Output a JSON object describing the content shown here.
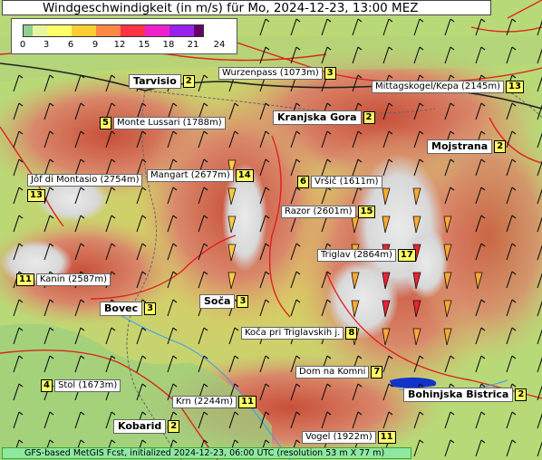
{
  "title": "Windgeschwindigkeit (in m/s) für Mo, 2024-12-23, 13:00 MEZ",
  "legend": {
    "ticks": [
      "0",
      "3",
      "6",
      "9",
      "12",
      "15",
      "18",
      "21",
      "24"
    ],
    "colors": [
      "#8fd18f",
      "#e8f5a0",
      "#ffff66",
      "#ffcc33",
      "#ff8844",
      "#ff3344",
      "#ee22cc",
      "#9922ee",
      "#660066"
    ]
  },
  "stations": [
    {
      "name": "Tarvisio",
      "value": "2",
      "bold": true
    },
    {
      "name": "Wurzenpass (1073m)",
      "value": "3",
      "bold": false
    },
    {
      "name": "Mittagskogel/Kepa (2145m)",
      "value": "13",
      "bold": false
    },
    {
      "name": "Monte Lussari (1788m)",
      "value": "5",
      "bold": false,
      "valueFirst": true
    },
    {
      "name": "Kranjska Gora",
      "value": "2",
      "bold": true
    },
    {
      "name": "Mojstrana",
      "value": "2",
      "bold": true
    },
    {
      "name": "Jôf di Montasio (2754m)",
      "value": "13",
      "bold": false,
      "valueBelow": true
    },
    {
      "name": "Mangart (2677m)",
      "value": "14",
      "bold": false
    },
    {
      "name": "Vršič (1611m)",
      "value": "6",
      "bold": false,
      "valueFirst": true
    },
    {
      "name": "Razor (2601m)",
      "value": "15",
      "bold": false
    },
    {
      "name": "Triglav (2864m)",
      "value": "17",
      "bold": false
    },
    {
      "name": "Kanin (2587m)",
      "value": "11",
      "bold": false,
      "valueFirst": true
    },
    {
      "name": "Bovec",
      "value": "3",
      "bold": true
    },
    {
      "name": "Soča",
      "value": "3",
      "bold": true
    },
    {
      "name": "Koča pri Triglavskih j.",
      "value": "8",
      "bold": false
    },
    {
      "name": "Dom na Komni",
      "value": "7",
      "bold": false
    },
    {
      "name": "Stol (1673m)",
      "value": "4",
      "bold": false,
      "valueFirst": true
    },
    {
      "name": "Bohinjska Bistrica",
      "value": "2",
      "bold": true
    },
    {
      "name": "Krn (2244m)",
      "value": "11",
      "bold": false
    },
    {
      "name": "Kobarid",
      "value": "2",
      "bold": true
    },
    {
      "name": "Vogel (1922m)",
      "value": "11",
      "bold": false
    }
  ],
  "footer": "GFS-based MetGIS Fcst, initialized 2024-12-23, 06:00 UTC  (resolution 53 m X 77 m)"
}
